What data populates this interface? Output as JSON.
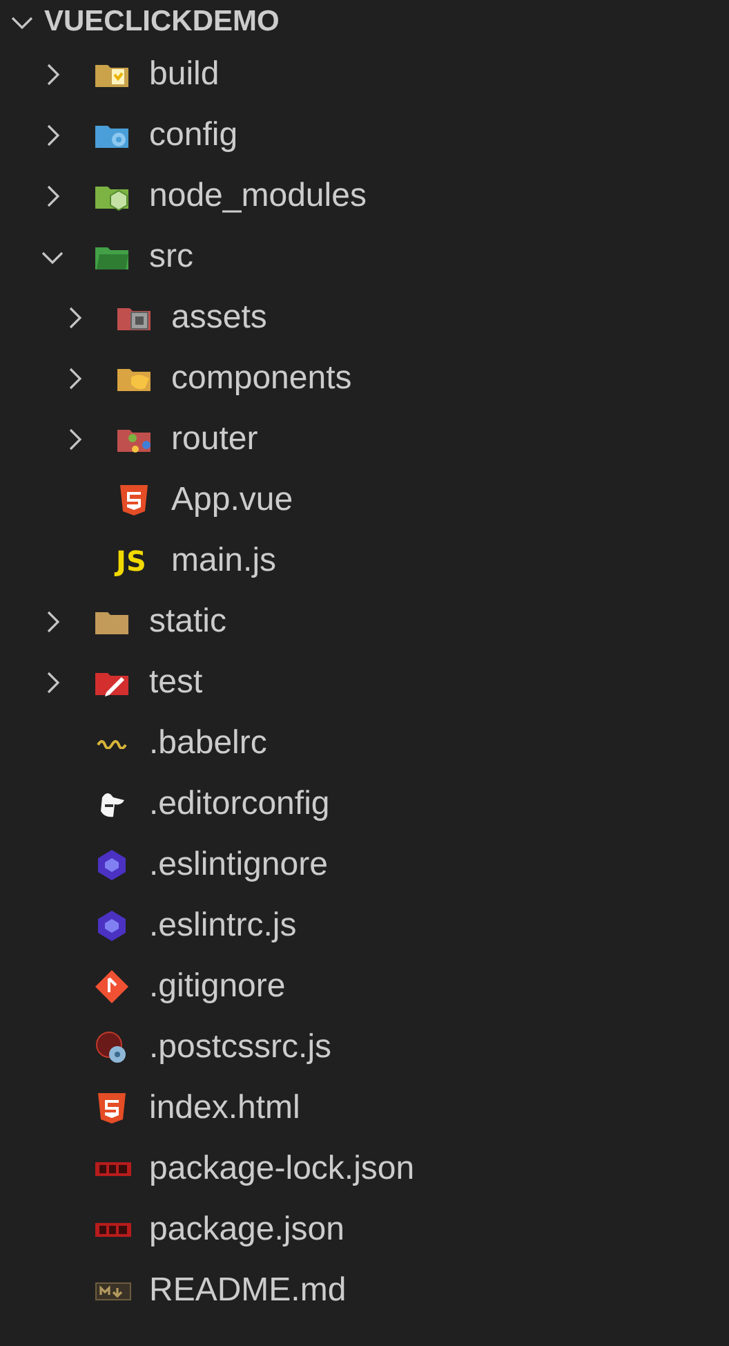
{
  "explorer": {
    "title": "VUECLICKDEMO",
    "expanded": true,
    "items": [
      {
        "name": "build",
        "kind": "buildfolder",
        "expanded": false
      },
      {
        "name": "config",
        "kind": "configfolder",
        "expanded": false
      },
      {
        "name": "node_modules",
        "kind": "nodefolder",
        "expanded": false
      },
      {
        "name": "src",
        "kind": "srcfolder",
        "expanded": true,
        "children": [
          {
            "name": "assets",
            "kind": "assetsfolder",
            "expanded": false
          },
          {
            "name": "components",
            "kind": "componentsfolder",
            "expanded": false
          },
          {
            "name": "router",
            "kind": "routerfolder",
            "expanded": false
          },
          {
            "name": "App.vue",
            "kind": "html"
          },
          {
            "name": "main.js",
            "kind": "js",
            "badge": "JS"
          }
        ]
      },
      {
        "name": "static",
        "kind": "staticfolder",
        "expanded": false
      },
      {
        "name": "test",
        "kind": "testfolder",
        "expanded": false
      },
      {
        "name": ".babelrc",
        "kind": "babel"
      },
      {
        "name": ".editorconfig",
        "kind": "editorconfig"
      },
      {
        "name": ".eslintignore",
        "kind": "eslint"
      },
      {
        "name": ".eslintrc.js",
        "kind": "eslint"
      },
      {
        "name": ".gitignore",
        "kind": "git"
      },
      {
        "name": ".postcssrc.js",
        "kind": "postcss"
      },
      {
        "name": "index.html",
        "kind": "html"
      },
      {
        "name": "package-lock.json",
        "kind": "npm"
      },
      {
        "name": "package.json",
        "kind": "npm"
      },
      {
        "name": "README.md",
        "kind": "markdown"
      }
    ]
  }
}
